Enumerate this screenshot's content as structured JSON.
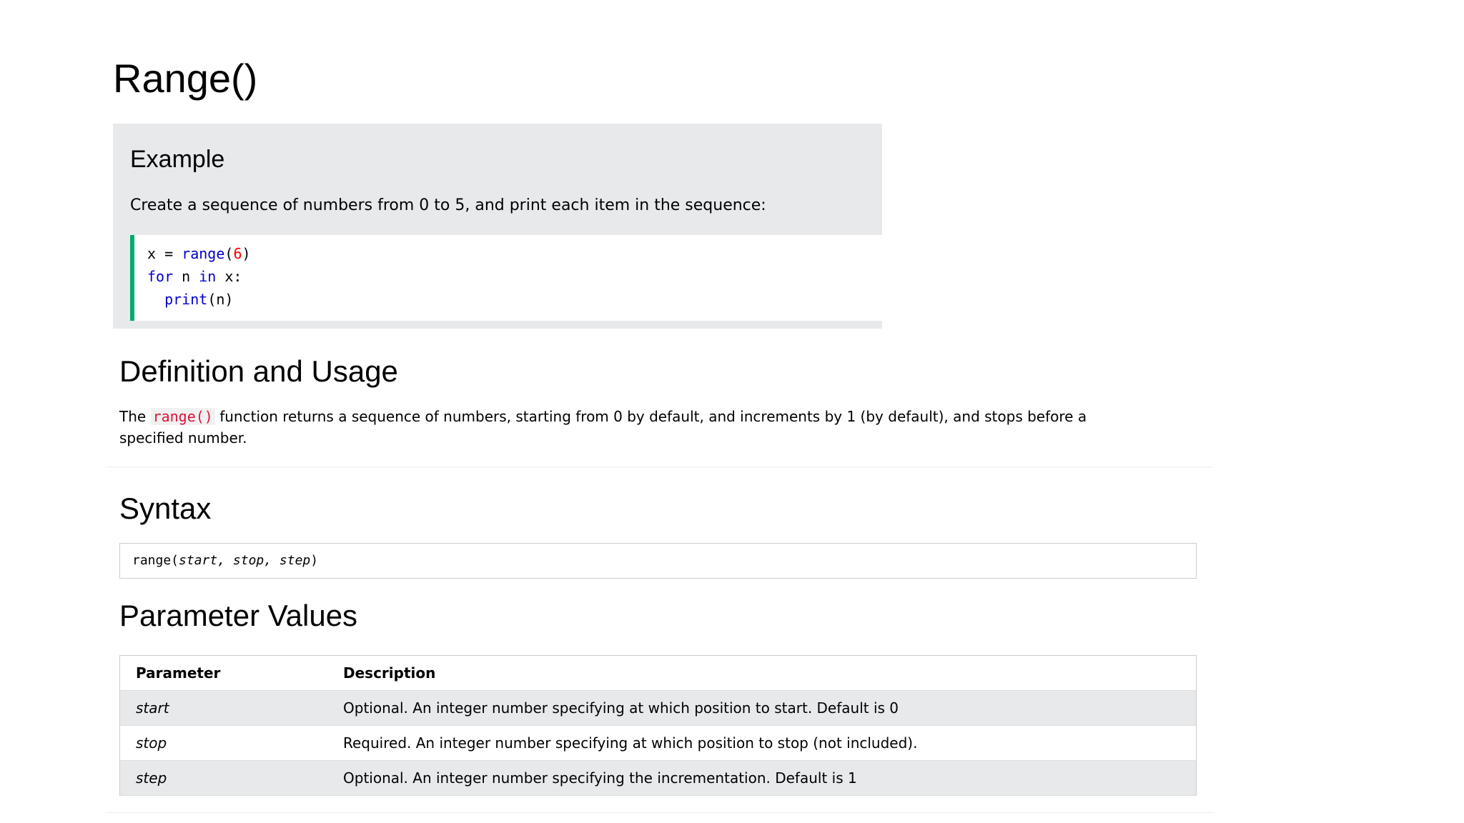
{
  "page": {
    "title": "Range()"
  },
  "example": {
    "heading": "Example",
    "description": "Create a sequence of numbers from 0 to 5, and print each item in the sequence:",
    "code": {
      "line1": {
        "var": "x",
        "op": " = ",
        "fn": "range",
        "open": "(",
        "num": "6",
        "close": ")"
      },
      "line2": {
        "kw1": "for",
        "var1": " n ",
        "kw2": "in",
        "rest": " x:"
      },
      "line3": {
        "indent": "  ",
        "fn": "print",
        "args": "(n)"
      }
    }
  },
  "definition": {
    "heading": "Definition and Usage",
    "prefix": "The ",
    "code": "range()",
    "suffix": " function returns a sequence of numbers, starting from 0 by default, and increments by 1 (by default), and stops before a specified number."
  },
  "syntax": {
    "heading": "Syntax",
    "fn": "range(",
    "args": "start, stop, step",
    "close": ")"
  },
  "parameters": {
    "heading": "Parameter Values",
    "headers": [
      "Parameter",
      "Description"
    ],
    "rows": [
      {
        "name": "start",
        "description": "Optional. An integer number specifying at which position to start. Default is 0"
      },
      {
        "name": "stop",
        "description": "Required. An integer number specifying at which position to stop (not included)."
      },
      {
        "name": "step",
        "description": "Optional. An integer number specifying the incrementation. Default is 1"
      }
    ]
  },
  "colors": {
    "example_bg": "#e7e9eb",
    "code_border": "#04aa6d",
    "keyword": "#0000cd",
    "number": "#ff0000",
    "inline_code": "#dc143c"
  }
}
